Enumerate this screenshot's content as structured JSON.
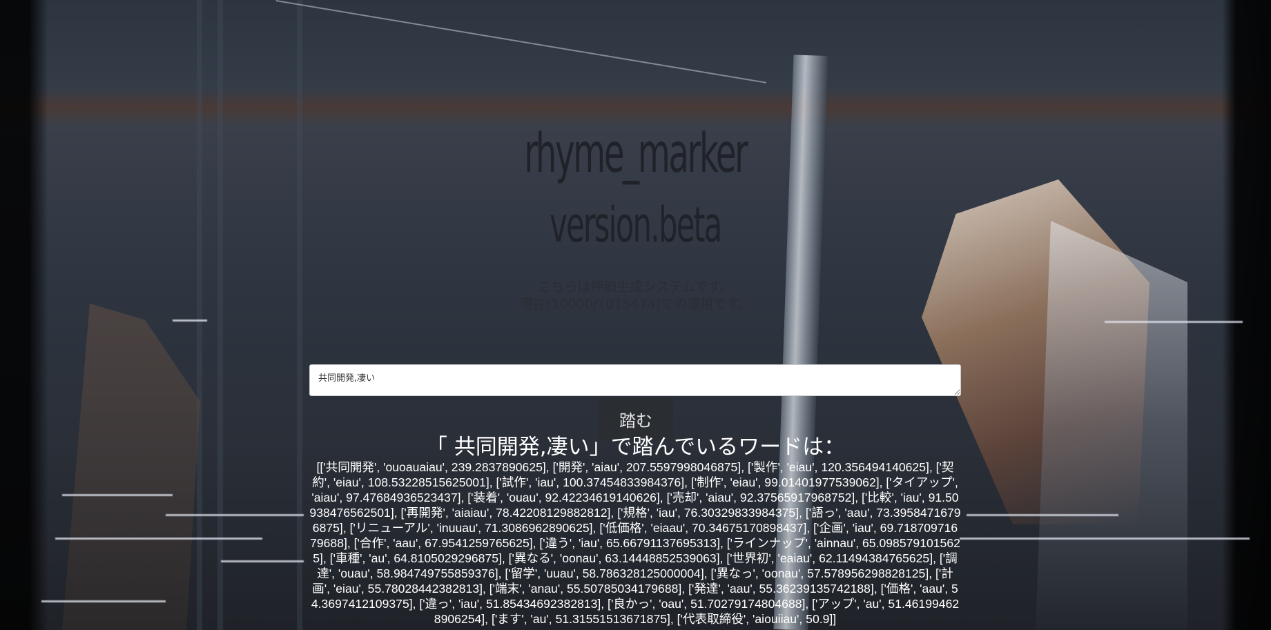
{
  "header": {
    "title": "rhyme_marker",
    "subtitle": "version.beta"
  },
  "description": {
    "line1": "こちらは押韻生成システムです。",
    "line2": "現在(10000/1015474)での運用です。"
  },
  "form": {
    "input_value": "共同開発,凄い",
    "submit_label": "踏む"
  },
  "result": {
    "heading": "「 共同開発,凄い」で踏んでいるワードは：",
    "body": "[['共同開発', 'ouoauaiau', 239.2837890625], ['開発', 'aiau', 207.5597998046875], ['製作', 'eiau', 120.356494140625], ['契約', 'eiau', 108.53228515625001], ['試作', 'iau', 100.37454833984376], ['制作', 'eiau', 99.01401977539062], ['タイアップ', 'aiau', 97.47684936523437], ['装着', 'ouau', 92.42234619140626], ['売却', 'aiau', 92.37565917968752], ['比較', 'iau', 91.50938476562501], ['再開発', 'aiaiau', 78.42208129882812], ['規格', 'iau', 76.30329833984375], ['語っ', 'aau', 73.39584716796875], ['リニューアル', 'inuuau', 71.3086962890625], ['低価格', 'eiaau', 70.34675170898437], ['企画', 'iau', 69.71870971679688], ['合作', 'aau', 67.9541259765625], ['違う', 'iau', 65.66791137695313], ['ラインナップ', 'ainnau', 65.0985791015625], ['車種', 'au', 64.8105029296875], ['異なる', 'oonau', 63.14448852539063], ['世界初', 'eaiau', 62.11494384765625], ['調達', 'ouau', 58.984749755859376], ['留学', 'uuau', 58.786328125000004], ['異なっ', 'oonau', 57.578956298828125], ['計画', 'eiau', 55.78028442382813], ['端末', 'anau', 55.50785034179688], ['発達', 'aau', 55.36239135742188], ['価格', 'aau', 54.3697412109375], ['違っ', 'iau', 51.85434692382813], ['良かっ', 'oau', 51.70279174804688], ['アップ', 'au', 51.461994628906254], ['ます', 'au', 51.31551513671875], ['代表取締役', 'aiouiiau', 50.9]]"
  }
}
